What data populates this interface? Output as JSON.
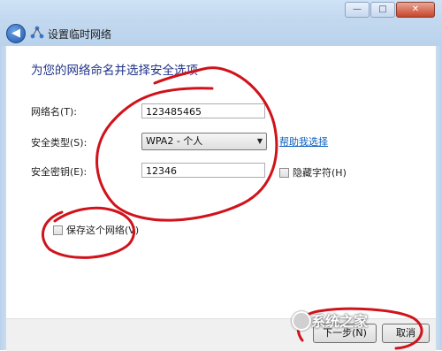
{
  "window": {
    "title": "设置临时网络",
    "controls": {
      "minimize": "—",
      "maximize": "□",
      "close": "✕"
    },
    "back_glyph": "◀"
  },
  "heading": "为您的网络命名并选择安全选项",
  "form": {
    "network_name": {
      "label": "网络名(T):",
      "value": "123485465"
    },
    "security_type": {
      "label": "安全类型(S):",
      "value": "WPA2 - 个人",
      "help_link": "帮助我选择"
    },
    "security_key": {
      "label": "安全密钥(E):",
      "value": "12346",
      "hide_chars_label": "隐藏字符(H)"
    },
    "save_network_label": "保存这个网络(V)"
  },
  "buttons": {
    "next": "下一步(N)",
    "cancel": "取消"
  },
  "watermark": {
    "text": "系统之家"
  },
  "colors": {
    "heading": "#1e3287",
    "annotation": "#d0131b",
    "link": "#0d5fbf"
  }
}
